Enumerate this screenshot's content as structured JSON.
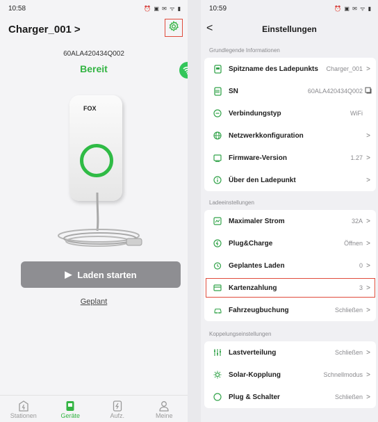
{
  "left": {
    "status_time": "10:58",
    "status_icons": "⏰ ▣ ✉ ᯤ ▮",
    "device_title": "Charger_001",
    "title_chevron": ">",
    "sn": "60ALA420434Q002",
    "status": "Bereit",
    "logo_text": "FOX",
    "start_label": "Laden starten",
    "planned_label": "Geplant",
    "nav": [
      {
        "label": "Stationen",
        "icon": "station-icon"
      },
      {
        "label": "Geräte",
        "icon": "charger-icon"
      },
      {
        "label": "Aufz.",
        "icon": "record-icon"
      },
      {
        "label": "Meine",
        "icon": "profile-icon"
      }
    ],
    "active_nav": "Geräte",
    "accent_color": "#33b443"
  },
  "right": {
    "status_time": "10:59",
    "status_icons": "⏰ ▣ ✉ ᯤ ▮",
    "title": "Einstellungen",
    "back": "<",
    "sections": [
      {
        "label": "Grundlegende Informationen",
        "rows": [
          {
            "label": "Spitzname des Ladepunkts",
            "value": "Charger_001",
            "chevron": ">",
            "icon": "id-card-icon"
          },
          {
            "label": "SN",
            "value": "60ALA420434Q002",
            "chevron": "",
            "icon": "barcode-icon",
            "copy": true
          },
          {
            "label": "Verbindungstyp",
            "value": "WiFi",
            "chevron": "",
            "icon": "connection-icon"
          },
          {
            "label": "Netzwerkkonfiguration",
            "value": "",
            "chevron": ">",
            "icon": "network-icon"
          },
          {
            "label": "Firmware-Version",
            "value": "1.27",
            "chevron": ">",
            "icon": "firmware-icon"
          },
          {
            "label": "Über den Ladepunkt",
            "value": "",
            "chevron": ">",
            "icon": "info-icon"
          }
        ]
      },
      {
        "label": "Ladeeinstellungen",
        "rows": [
          {
            "label": "Maximaler Strom",
            "value": "32A",
            "chevron": ">",
            "icon": "current-icon"
          },
          {
            "label": "Plug&Charge",
            "value": "Öffnen",
            "chevron": ">",
            "icon": "plug-icon"
          },
          {
            "label": "Geplantes Laden",
            "value": "0",
            "chevron": ">",
            "icon": "clock-icon"
          },
          {
            "label": "Kartenzahlung",
            "value": "3",
            "chevron": ">",
            "icon": "card-icon",
            "highlight": true
          },
          {
            "label": "Fahrzeugbuchung",
            "value": "Schließen",
            "chevron": ">",
            "icon": "car-icon"
          }
        ]
      },
      {
        "label": "Koppelungseinstellungen",
        "rows": [
          {
            "label": "Lastverteilung",
            "value": "Schließen",
            "chevron": ">",
            "icon": "load-icon"
          },
          {
            "label": "Solar-Kopplung",
            "value": "Schnellmodus",
            "chevron": ">",
            "icon": "solar-icon"
          },
          {
            "label": "Plug & Schalter",
            "value": "Schließen",
            "chevron": ">",
            "icon": "switch-icon"
          }
        ]
      }
    ]
  }
}
